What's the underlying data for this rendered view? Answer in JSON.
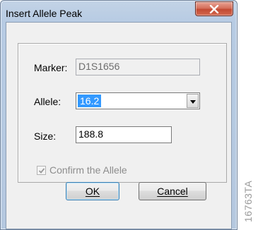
{
  "window": {
    "title": "Insert Allele Peak"
  },
  "fields": {
    "marker_label": "Marker:",
    "marker_value": "D1S1656",
    "allele_label": "Allele:",
    "allele_value": "16.2",
    "size_label": "Size:",
    "size_value": "188.8"
  },
  "confirm": {
    "label": "Confirm the Allele",
    "checked": true,
    "enabled": false
  },
  "buttons": {
    "ok_label": "OK",
    "cancel_label": "Cancel"
  },
  "watermark": {
    "text": "16763TA"
  },
  "icons": {
    "close": "close-icon",
    "dropdown": "chevron-down-icon",
    "check": "checkmark-icon"
  }
}
